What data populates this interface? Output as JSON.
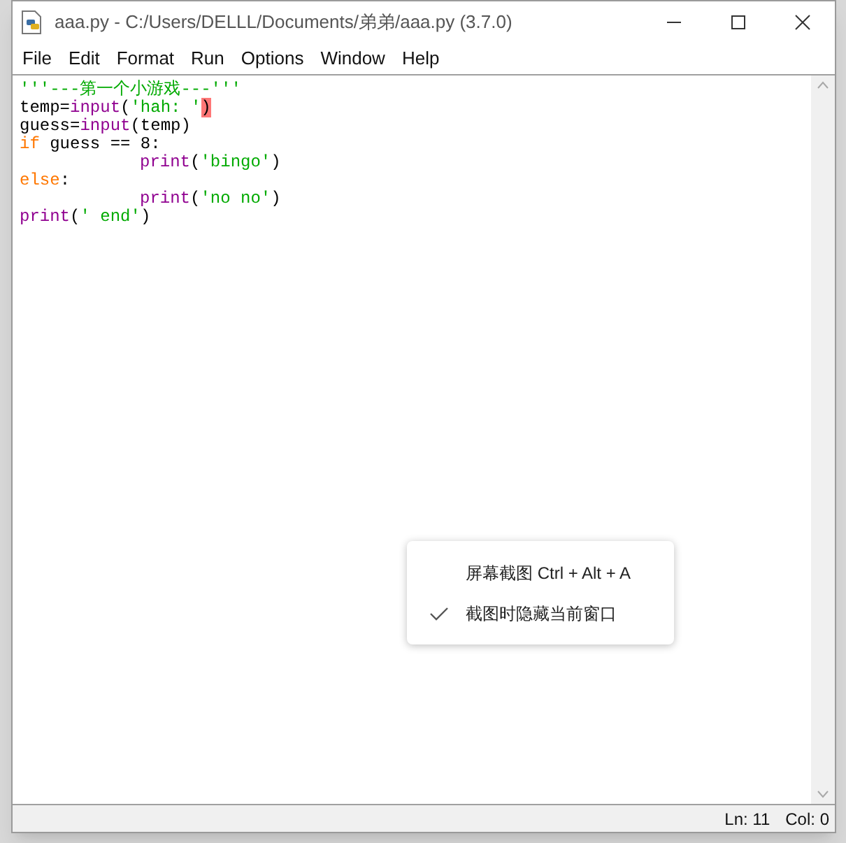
{
  "window": {
    "title": "aaa.py - C:/Users/DELLL/Documents/弟弟/aaa.py (3.7.0)"
  },
  "menu": [
    "File",
    "Edit",
    "Format",
    "Run",
    "Options",
    "Window",
    "Help"
  ],
  "code": {
    "lines": [
      [
        {
          "kind": "string",
          "text": "'''---第一个小游戏---'''"
        }
      ],
      [
        {
          "kind": "plain",
          "text": "temp="
        },
        {
          "kind": "builtin",
          "text": "input"
        },
        {
          "kind": "plain",
          "text": "("
        },
        {
          "kind": "string",
          "text": "'hah: '"
        },
        {
          "kind": "match",
          "text": ")"
        }
      ],
      [
        {
          "kind": "plain",
          "text": "guess="
        },
        {
          "kind": "builtin",
          "text": "input"
        },
        {
          "kind": "plain",
          "text": "(temp)"
        }
      ],
      [
        {
          "kind": "keyword",
          "text": "if"
        },
        {
          "kind": "plain",
          "text": " guess == 8:"
        }
      ],
      {
        "indented": true,
        "tokens": [
          {
            "kind": "builtin",
            "text": "print"
          },
          {
            "kind": "plain",
            "text": "("
          },
          {
            "kind": "string",
            "text": "'bingo'"
          },
          {
            "kind": "plain",
            "text": ")"
          }
        ]
      },
      [
        {
          "kind": "keyword",
          "text": "else"
        },
        {
          "kind": "plain",
          "text": ":"
        }
      ],
      {
        "indented": true,
        "tokens": [
          {
            "kind": "builtin",
            "text": "print"
          },
          {
            "kind": "plain",
            "text": "("
          },
          {
            "kind": "string",
            "text": "'no no'"
          },
          {
            "kind": "plain",
            "text": ")"
          }
        ]
      },
      [
        {
          "kind": "builtin",
          "text": "print"
        },
        {
          "kind": "plain",
          "text": "("
        },
        {
          "kind": "string",
          "text": "' end'"
        },
        {
          "kind": "plain",
          "text": ")"
        }
      ]
    ]
  },
  "status_bar": {
    "line": "Ln: 11",
    "column": "Col: 0"
  },
  "context_menu": [
    {
      "label": "屏幕截图 Ctrl + Alt + A",
      "checked": false
    },
    {
      "label": "截图时隐藏当前窗口",
      "checked": true
    }
  ]
}
